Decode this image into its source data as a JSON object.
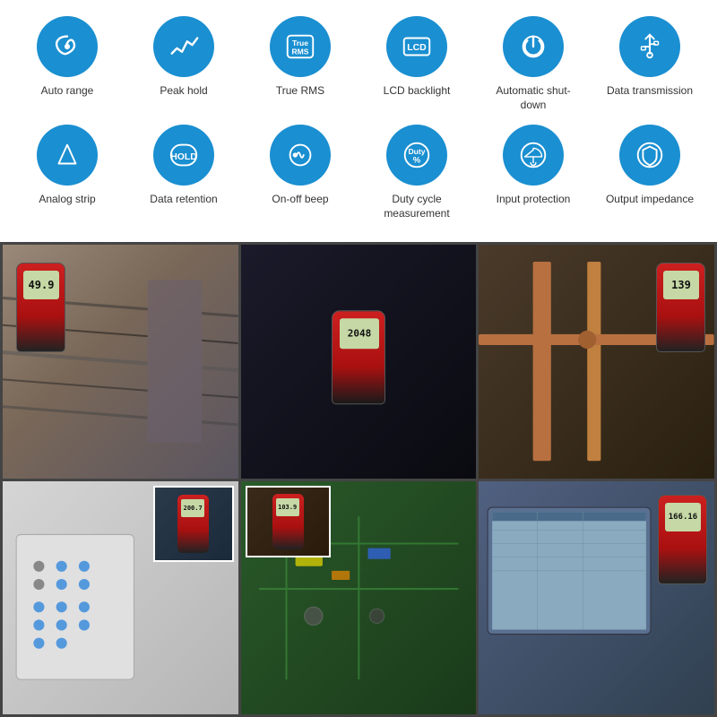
{
  "features": {
    "row1": [
      {
        "id": "auto-range",
        "label": "Auto range",
        "icon": "spiral"
      },
      {
        "id": "peak-hold",
        "label": "Peak hold",
        "icon": "wave"
      },
      {
        "id": "true-rms",
        "label": "True RMS",
        "icon": "true-rms-text"
      },
      {
        "id": "lcd-backlight",
        "label": "LCD backlight",
        "icon": "lcd-text"
      },
      {
        "id": "auto-shutdown",
        "label": "Automatic shut-down",
        "icon": "power"
      },
      {
        "id": "data-transmission",
        "label": "Data transmission",
        "icon": "usb"
      }
    ],
    "row2": [
      {
        "id": "analog-strip",
        "label": "Analog strip",
        "icon": "arrow"
      },
      {
        "id": "data-retention",
        "label": "Data retention",
        "icon": "hold-text"
      },
      {
        "id": "onoff-beep",
        "label": "On-off beep",
        "icon": "sound"
      },
      {
        "id": "duty-cycle",
        "label": "Duty cycle measurement",
        "icon": "duty-text"
      },
      {
        "id": "input-protection",
        "label": "Input protection",
        "icon": "umbrella"
      },
      {
        "id": "output-impedance",
        "label": "Output impedance",
        "icon": "shield"
      }
    ]
  },
  "meters": {
    "top_left_reading": "49.9",
    "top_middle_reading": "2048",
    "top_right_reading": "139",
    "bottom_left_small": "200.7",
    "bottom_middle_small": "103.9",
    "bottom_right_small": "166.16"
  },
  "accent_color": "#1a8fd1"
}
